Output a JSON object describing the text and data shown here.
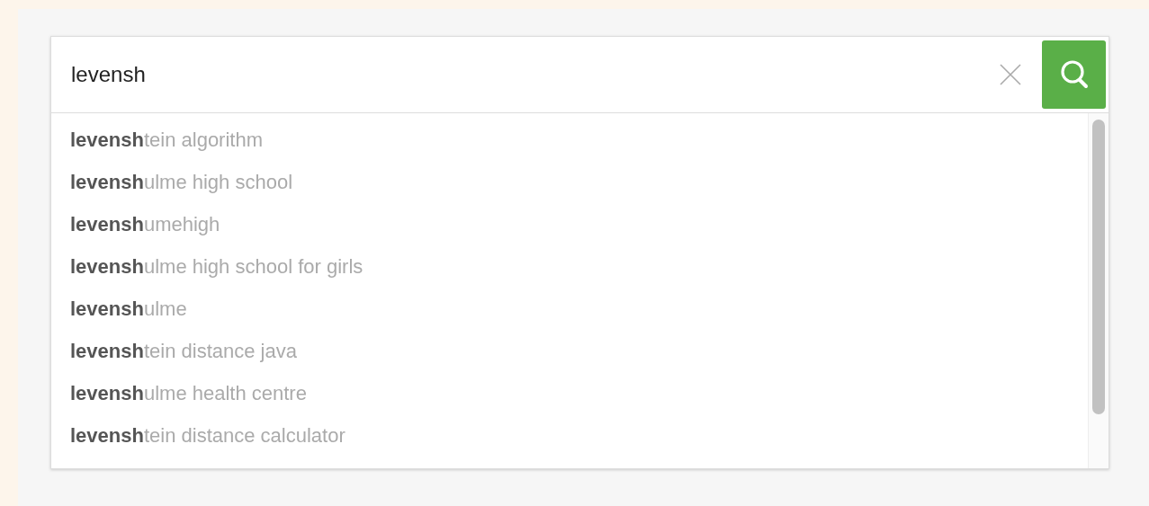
{
  "search": {
    "value": "levensh"
  },
  "suggestions": [
    {
      "text": "**levensh**tein algorithm"
    },
    {
      "text": "**levensh**ulme high school"
    },
    {
      "text": "**levensh**umehigh"
    },
    {
      "text": "**levensh**ulme high school for girls"
    },
    {
      "text": "**levensh**ulme"
    },
    {
      "text": "**levensh**tein distance java"
    },
    {
      "text": "**levensh**ulme health centre"
    },
    {
      "text": "**levensh**tein distance calculator"
    }
  ]
}
